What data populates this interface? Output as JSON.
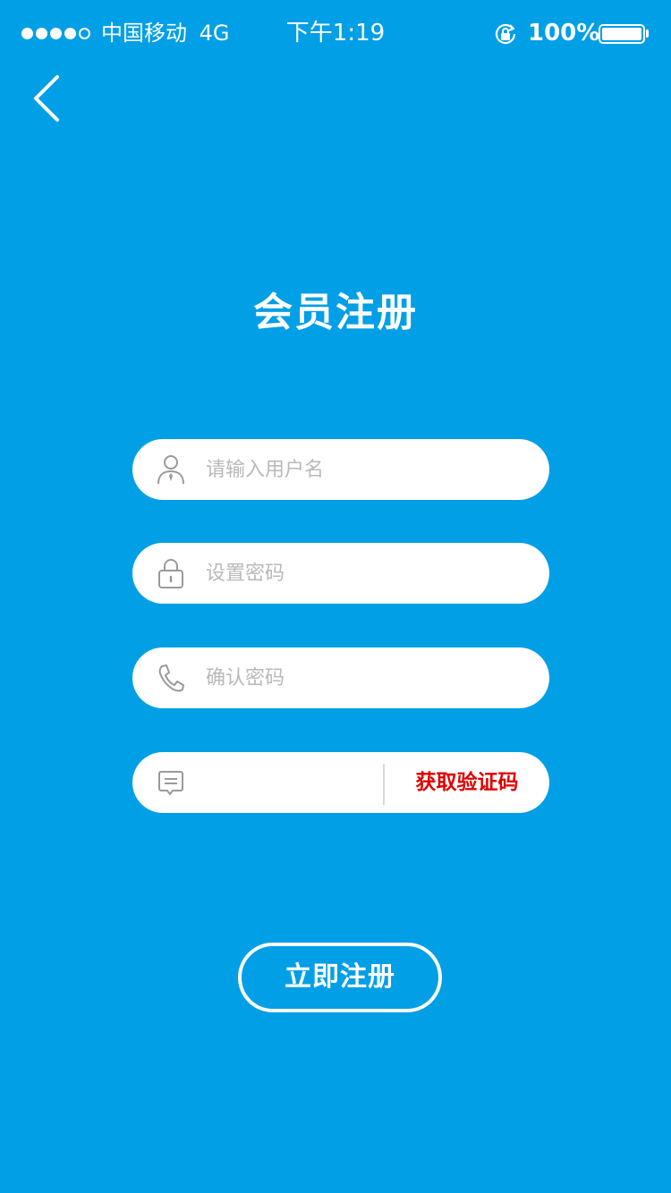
{
  "status_bar": {
    "carrier": "中国移动",
    "network": "4G",
    "time": "下午1:19",
    "battery_percent": "100%",
    "battery_level": 1.0,
    "signal_bars_filled": 4,
    "signal_bars_total": 5,
    "icons": [
      "rotation-lock-icon",
      "battery-icon"
    ]
  },
  "nav": {
    "back_icon": "chevron-left-icon"
  },
  "page": {
    "title": "会员注册"
  },
  "form": {
    "username": {
      "icon": "user-icon",
      "value": "",
      "placeholder": "请输入用户名"
    },
    "password": {
      "icon": "lock-icon",
      "value": "",
      "placeholder": "设置密码"
    },
    "confirm_password": {
      "icon": "phone-icon",
      "value": "",
      "placeholder": "确认密码"
    },
    "verification_code": {
      "icon": "message-icon",
      "value": "",
      "placeholder": "",
      "get_code_label": "获取验证码"
    },
    "submit_label": "立即注册"
  },
  "colors": {
    "background": "#009fe6",
    "field_bg": "#ffffff",
    "placeholder": "#b9b9b9",
    "accent_red": "#e00000",
    "icon_gray": "#9a9a9a"
  }
}
